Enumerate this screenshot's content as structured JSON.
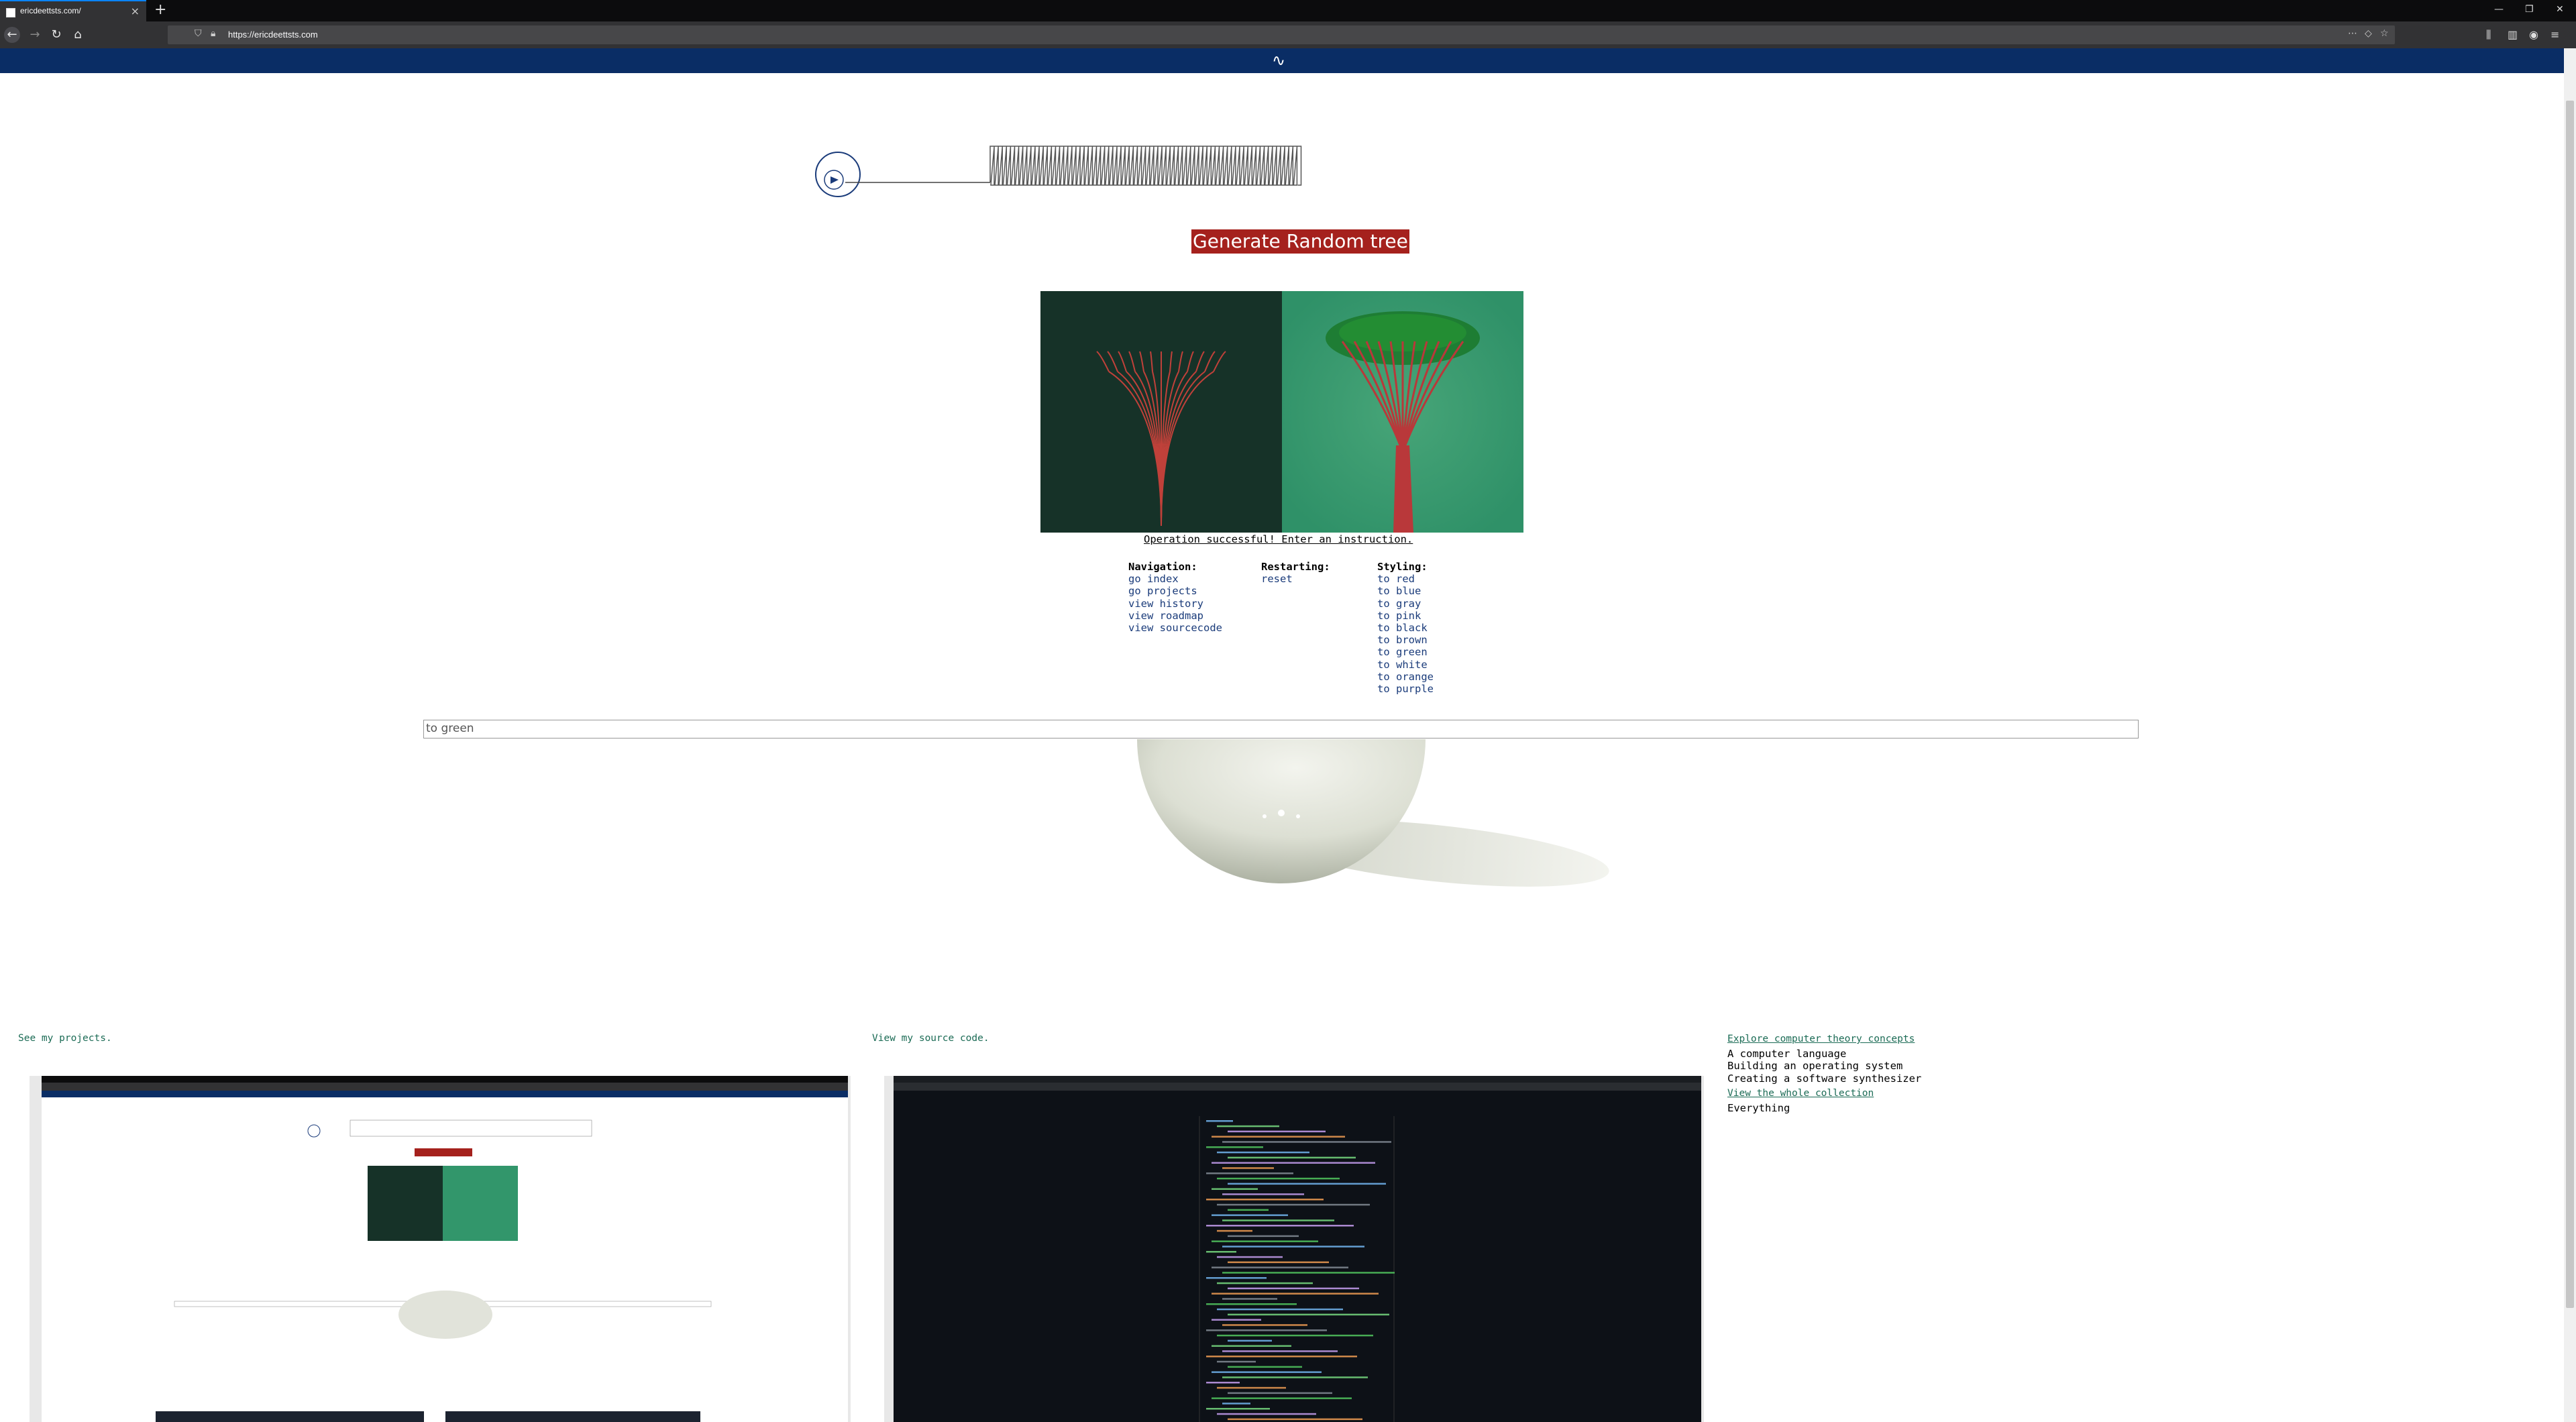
{
  "browser": {
    "tab_title": "ericdeettsts.com/",
    "tab_close": "×",
    "new_tab": "+",
    "url": "https://ericdeettsts.com",
    "window_controls": [
      "—",
      "❐",
      "✕"
    ]
  },
  "site": {
    "logo": "∿",
    "generate_label": "Generate Random tree",
    "status": "Operation successful! Enter an instruction.",
    "navigation": {
      "heading": "Navigation:",
      "items": [
        "go index",
        "go projects",
        "view history",
        "view roadmap",
        "view sourcecode"
      ]
    },
    "restarting": {
      "heading": "Restarting:",
      "items": [
        "reset"
      ]
    },
    "styling": {
      "heading": "Styling:",
      "items": [
        "to red",
        "to blue",
        "to gray",
        "to pink",
        "to black",
        "to brown",
        "to green",
        "to white",
        "to orange",
        "to purple"
      ]
    },
    "input_value": "to green",
    "projects_link": "See my projects.",
    "source_link": "View my source code.",
    "theory": {
      "link": "Explore computer theory concepts",
      "items": [
        "A computer language",
        "Building an operating system",
        "Creating a software synthesizer"
      ],
      "collection_link": "View the whole collection",
      "collection_items": [
        "Everything"
      ]
    }
  },
  "colors": {
    "header": "#0a2d65",
    "button": "#a5211d",
    "tree_left_bg": "#163228",
    "tree_right_bg": "#32966b",
    "link": "#1b6b55"
  }
}
